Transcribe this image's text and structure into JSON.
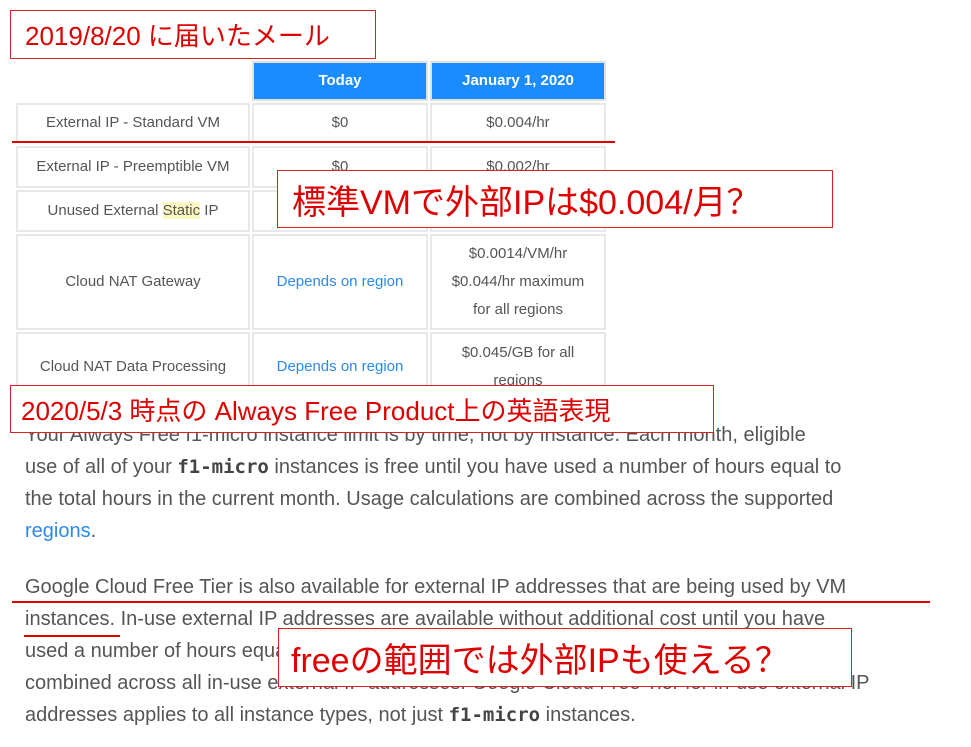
{
  "table": {
    "headers": [
      "Today",
      "January 1, 2020"
    ],
    "rows": [
      {
        "label": "External IP - Standard VM",
        "today": "$0",
        "jan": [
          "$0.004/hr"
        ]
      },
      {
        "label": "External IP - Preemptible VM",
        "today": "$0",
        "jan": [
          "$0.002/hr"
        ]
      },
      {
        "label_pre": "Unused External ",
        "label_hl": "Static",
        "label_post": " IP"
      },
      {
        "label": "Cloud NAT Gateway",
        "today": "Depends on region",
        "jan": [
          "$0.0014/VM/hr",
          "$0.044/hr maximum",
          "for all regions"
        ]
      },
      {
        "label": "Cloud NAT Data Processing",
        "today": "Depends on region",
        "jan": [
          "$0.045/GB for all",
          "regions"
        ]
      }
    ]
  },
  "para1": {
    "l1": "Your Always Free f1-micro instance limit is by time, not by instance. Each month, eligible",
    "l2a": "use of all of your ",
    "code": "f1-micro",
    "l2b": " instances is free until you have used a number of hours equal to",
    "l3": "the total hours in the current month. Usage calculations are combined across the supported",
    "link": "regions",
    "l4b": "."
  },
  "para2": {
    "l1": "Google Cloud Free Tier is also available for external IP addresses that are being used by VM",
    "l2": "instances. In-use external IP addresses are available without additional cost until you have",
    "l3": "used a number of hours equal to the total hours in the current month. Usage calculations are",
    "l4": "combined across all in-use external IP addresses. Google Cloud Free Tier for in-use external IP",
    "l5a": "addresses applies to all instance types, not just ",
    "code": "f1-micro",
    "l5b": " instances."
  },
  "annotations": {
    "a1": "2019/8/20 に届いたメール",
    "a2": "標準VMで外部IPは$0.004/月？",
    "a3": "2020/5/3 時点の Always Free Product上の英語表現",
    "a4": "freeの範囲では外部IPも使える？"
  },
  "colors": {
    "header": "#1a8cff",
    "annotation": "#e02020",
    "link": "#2b8ae8"
  }
}
